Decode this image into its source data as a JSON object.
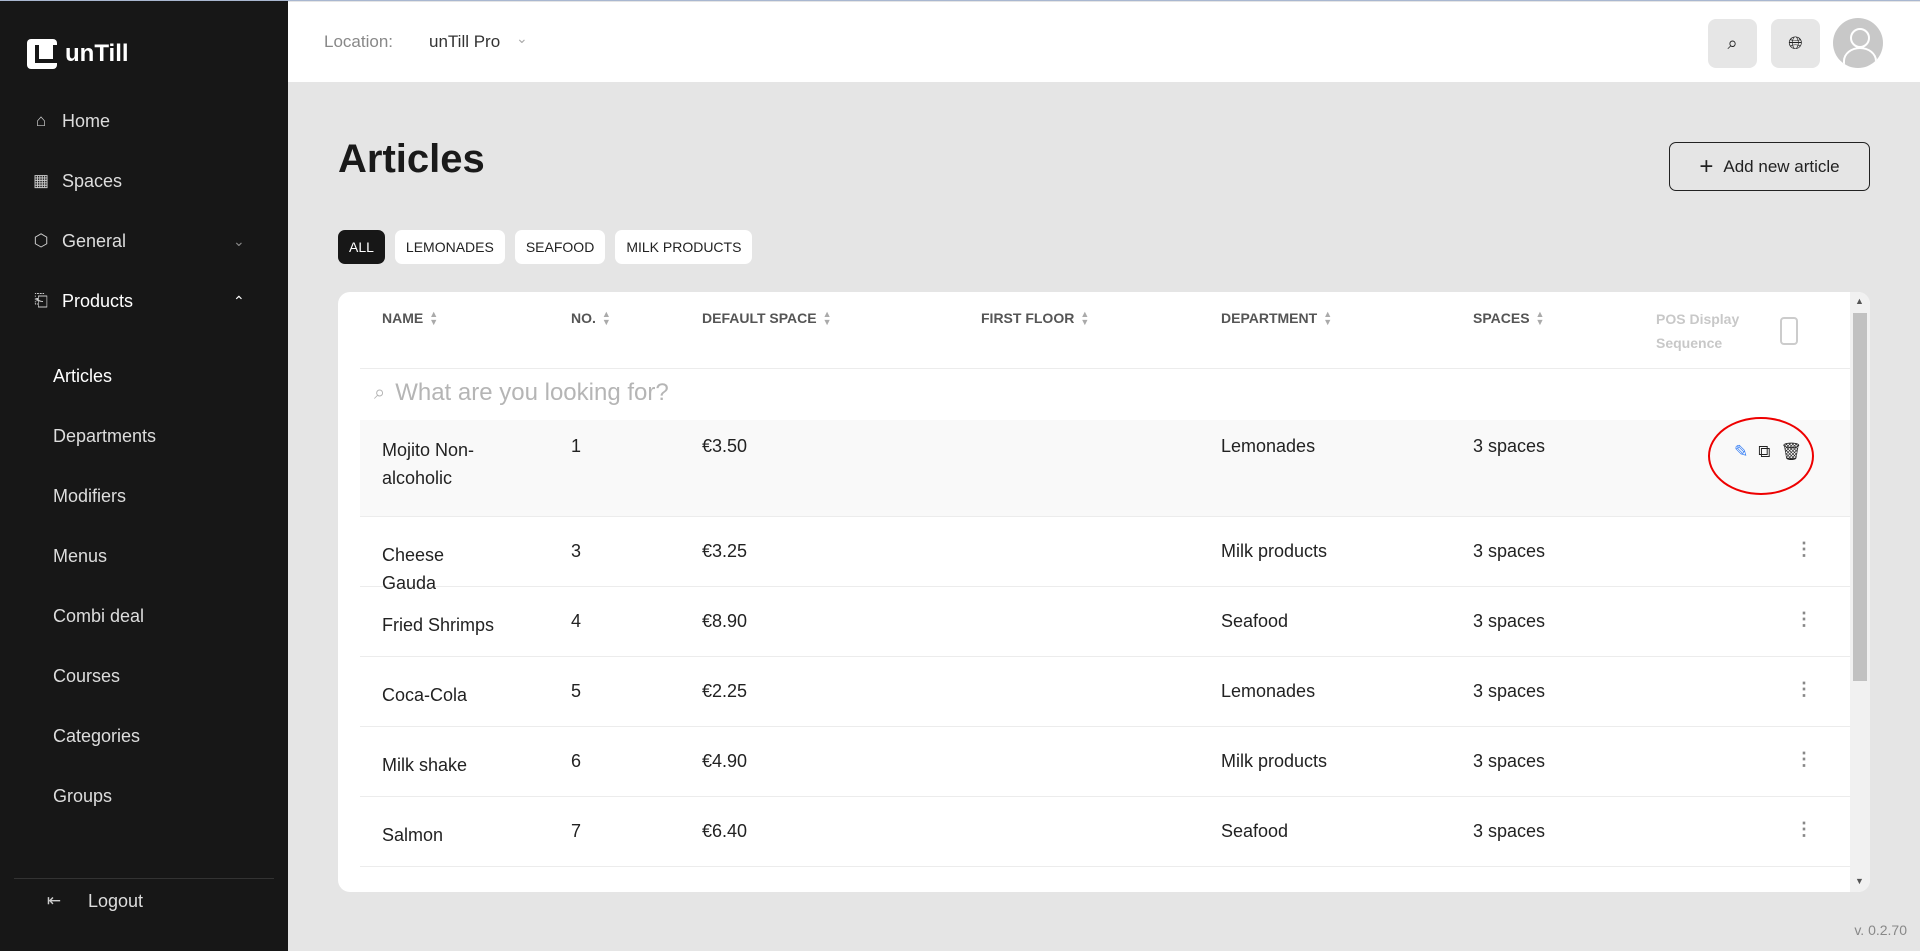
{
  "app": {
    "logo": "unTill",
    "version": "v. 0.2.70"
  },
  "sidebar": {
    "items": [
      {
        "label": "Home",
        "icon": "home-icon"
      },
      {
        "label": "Spaces",
        "icon": "grid-icon"
      },
      {
        "label": "General",
        "icon": "gear-icon",
        "expanded": false
      },
      {
        "label": "Products",
        "icon": "products-icon",
        "expanded": true
      }
    ],
    "sub_items": [
      "Articles",
      "Departments",
      "Modifiers",
      "Menus",
      "Combi deal",
      "Courses",
      "Categories",
      "Groups"
    ],
    "active_sub": "Articles",
    "logout": "Logout"
  },
  "header": {
    "location_label": "Location:",
    "location_value": "unTill Pro"
  },
  "page": {
    "title": "Articles",
    "add_button": "Add new article",
    "filters": [
      "ALL",
      "LEMONADES",
      "SEAFOOD",
      "MILK PRODUCTS"
    ],
    "active_filter": "ALL"
  },
  "table": {
    "columns": [
      "NAME",
      "NO.",
      "DEFAULT SPACE",
      "FIRST FLOOR",
      "DEPARTMENT",
      "SPACES"
    ],
    "pos_column": "POS Display Sequence",
    "search_placeholder": "What are you looking for?",
    "rows": [
      {
        "name": "Mojito Non-alcoholic",
        "no": "1",
        "price": "€3.50",
        "first_floor": "",
        "department": "Lemonades",
        "spaces": "3 spaces"
      },
      {
        "name": "Cheese Gauda",
        "no": "3",
        "price": "€3.25",
        "first_floor": "",
        "department": "Milk products",
        "spaces": "3 spaces"
      },
      {
        "name": "Fried Shrimps",
        "no": "4",
        "price": "€8.90",
        "first_floor": "",
        "department": "Seafood",
        "spaces": "3 spaces"
      },
      {
        "name": "Coca-Cola",
        "no": "5",
        "price": "€2.25",
        "first_floor": "",
        "department": "Lemonades",
        "spaces": "3 spaces"
      },
      {
        "name": "Milk shake",
        "no": "6",
        "price": "€4.90",
        "first_floor": "",
        "department": "Milk products",
        "spaces": "3 spaces"
      },
      {
        "name": "Salmon",
        "no": "7",
        "price": "€6.40",
        "first_floor": "",
        "department": "Seafood",
        "spaces": "3 spaces"
      }
    ]
  },
  "colors": {
    "sidebar": "#171717",
    "accent_edit": "#3b82f6",
    "highlight_ring": "#e00000"
  }
}
